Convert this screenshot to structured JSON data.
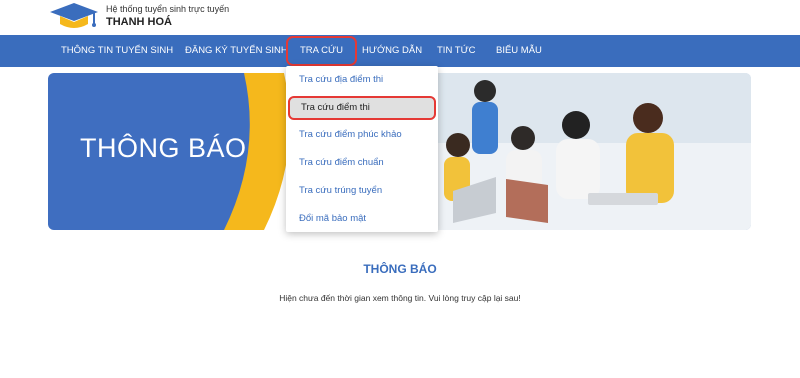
{
  "site": {
    "subtitle": "Hệ thống tuyển sinh trực tuyến",
    "name": "THANH HOÁ"
  },
  "nav": {
    "items": [
      {
        "label": "THÔNG TIN TUYỂN SINH"
      },
      {
        "label": "ĐĂNG KÝ TUYỂN SINH"
      },
      {
        "label": "TRA CỨU"
      },
      {
        "label": "HƯỚNG DẪN"
      },
      {
        "label": "TIN TỨC"
      },
      {
        "label": "BIỂU MẪU"
      }
    ],
    "active": "TRA CỨU"
  },
  "dropdown": {
    "items": [
      {
        "label": "Tra cứu địa điểm thi"
      },
      {
        "label": "Tra cứu điểm thi"
      },
      {
        "label": "Tra cứu điểm phúc khảo"
      },
      {
        "label": "Tra cứu điểm chuẩn"
      },
      {
        "label": "Tra cứu trúng tuyển"
      },
      {
        "label": "Đổi mã bảo mật"
      }
    ],
    "highlighted": "Tra cứu điểm thi"
  },
  "banner": {
    "title": "THÔNG BÁO"
  },
  "notice": {
    "title": "THÔNG BÁO",
    "message": "Hiện chưa đến thời gian xem thông tin. Vui lòng truy cập lại sau!"
  },
  "colors": {
    "primary": "#3a6dbd",
    "accent": "#f5b81c",
    "highlight_border": "#e53935"
  }
}
